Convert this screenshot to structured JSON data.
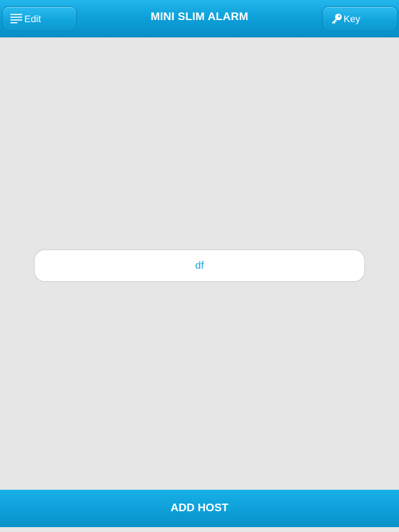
{
  "colors": {
    "accent": "#0e9fd8",
    "background": "#e6e6e6",
    "host_text": "#1aa6dc"
  },
  "header": {
    "title": "MINI SLIM ALARM",
    "edit_button": {
      "label": "Edit",
      "icon": "menu-lines-icon"
    },
    "key_button": {
      "label": "Key",
      "icon": "key-icon"
    }
  },
  "hosts": [
    {
      "name": "df"
    }
  ],
  "footer": {
    "add_host_label": "ADD HOST"
  }
}
